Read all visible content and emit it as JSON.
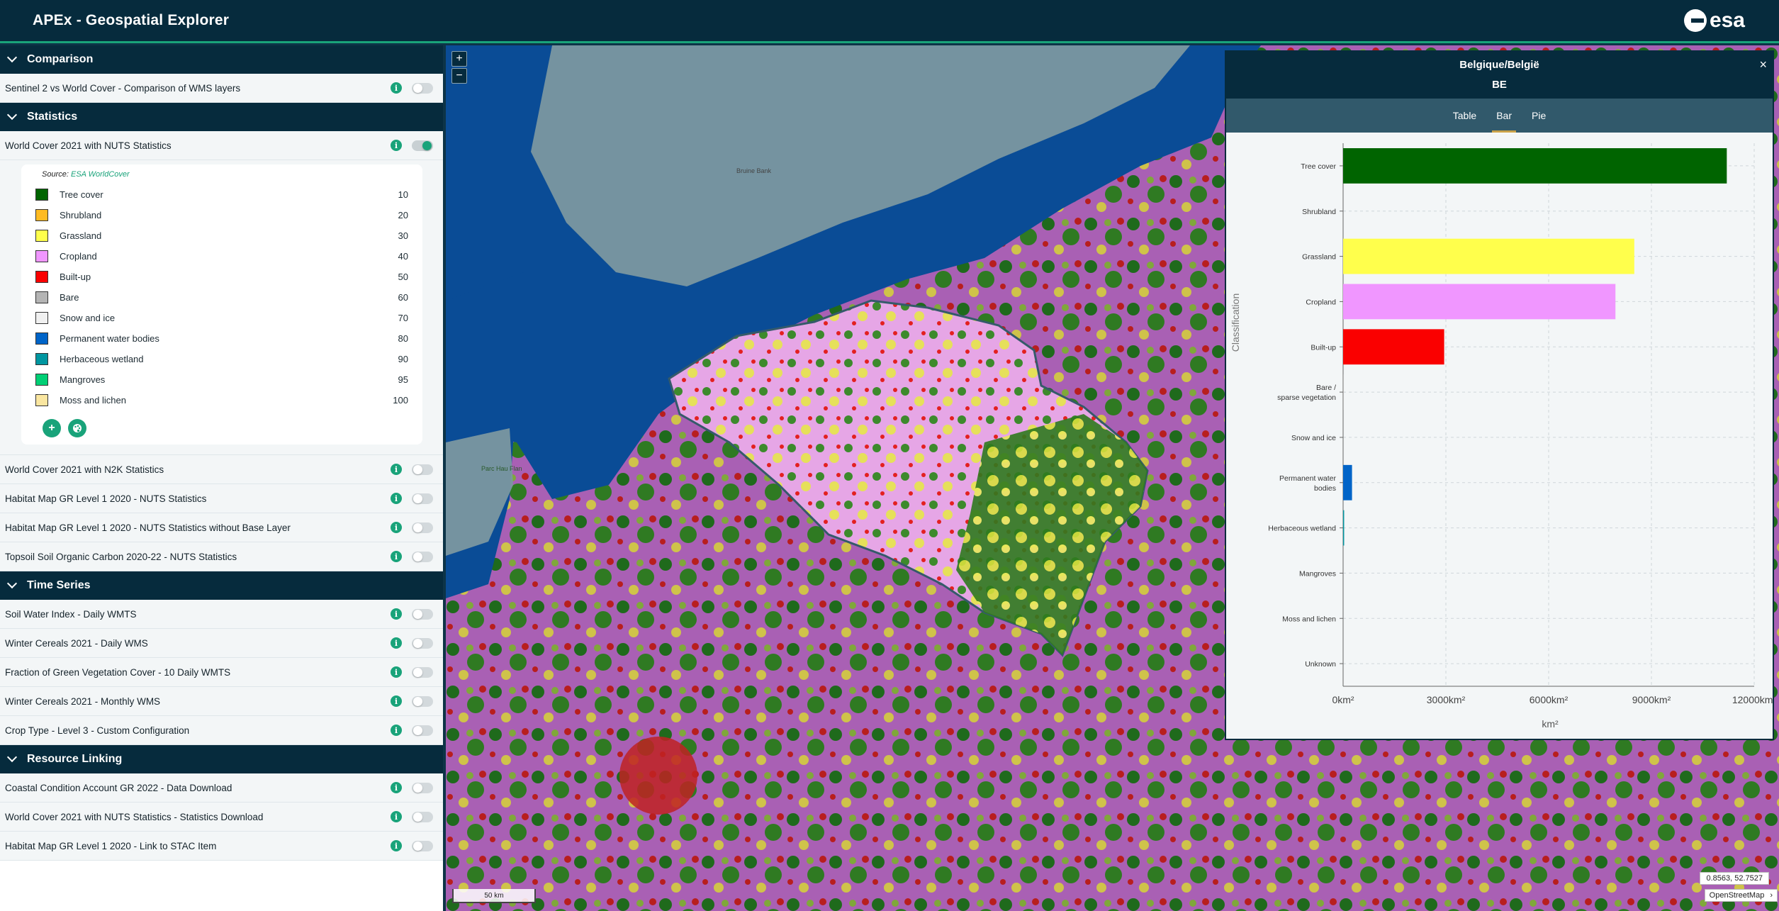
{
  "app": {
    "title": "APEx - Geospatial Explorer",
    "logo_text": "esa"
  },
  "sidebar": {
    "sections": [
      {
        "title": "Comparison",
        "layers": [
          {
            "label": "Sentinel 2 vs World Cover - Comparison of WMS layers",
            "on": false
          }
        ]
      },
      {
        "title": "Statistics",
        "layers": [
          {
            "label": "World Cover 2021 with NUTS Statistics",
            "on": true
          },
          {
            "label": "World Cover 2021 with N2K Statistics",
            "on": false
          },
          {
            "label": "Habitat Map GR Level 1 2020 - NUTS Statistics",
            "on": false
          },
          {
            "label": "Habitat Map GR Level 1 2020 - NUTS Statistics without Base Layer",
            "on": false
          },
          {
            "label": "Topsoil Soil Organic Carbon 2020-22 - NUTS Statistics",
            "on": false
          }
        ]
      },
      {
        "title": "Time Series",
        "layers": [
          {
            "label": "Soil Water Index - Daily WMTS",
            "on": false
          },
          {
            "label": "Winter Cereals 2021 - Daily WMS",
            "on": false
          },
          {
            "label": "Fraction of Green Vegetation Cover - 10 Daily WMTS",
            "on": false
          },
          {
            "label": "Winter Cereals 2021 - Monthly WMS",
            "on": false
          },
          {
            "label": "Crop Type - Level 3 - Custom Configuration",
            "on": false
          }
        ]
      },
      {
        "title": "Resource Linking",
        "layers": [
          {
            "label": "Coastal Condition Account GR 2022 - Data Download",
            "on": false
          },
          {
            "label": "World Cover 2021 with NUTS Statistics - Statistics Download",
            "on": false
          },
          {
            "label": "Habitat Map GR Level 1 2020 - Link to STAC Item",
            "on": false
          }
        ]
      }
    ],
    "legend": {
      "source_prefix": "Source:",
      "source_link": "ESA WorldCover",
      "items": [
        {
          "name": "Tree cover",
          "value": "10",
          "color": "#006400"
        },
        {
          "name": "Shrubland",
          "value": "20",
          "color": "#ffbb22"
        },
        {
          "name": "Grassland",
          "value": "30",
          "color": "#ffff4c"
        },
        {
          "name": "Cropland",
          "value": "40",
          "color": "#f096ff"
        },
        {
          "name": "Built-up",
          "value": "50",
          "color": "#fa0000"
        },
        {
          "name": "Bare",
          "value": "60",
          "color": "#b4b4b4"
        },
        {
          "name": "Snow and ice",
          "value": "70",
          "color": "#f0f0f0"
        },
        {
          "name": "Permanent water bodies",
          "value": "80",
          "color": "#0064c8"
        },
        {
          "name": "Herbaceous wetland",
          "value": "90",
          "color": "#0096a0"
        },
        {
          "name": "Mangroves",
          "value": "95",
          "color": "#00cf75"
        },
        {
          "name": "Moss and lichen",
          "value": "100",
          "color": "#fae6a0"
        }
      ],
      "add_icon": "+",
      "palette_icon": "palette-icon"
    }
  },
  "map": {
    "zoom_in": "+",
    "zoom_out": "−",
    "scale": "50 km",
    "coords": "0.8563, 52.7527",
    "attribution": "OpenStreetMap",
    "attribution_toggle": "›",
    "place_labels": [
      "Bruine Bank",
      "Parc Hau Flan"
    ]
  },
  "stats_panel": {
    "title": "Belgique/België",
    "code": "BE",
    "close": "×",
    "tabs": [
      "Table",
      "Bar",
      "Pie"
    ],
    "active_tab": "Bar"
  },
  "chart_data": {
    "type": "bar",
    "orientation": "horizontal",
    "categories": [
      "Tree cover",
      "Shrubland",
      "Grassland",
      "Cropland",
      "Built-up",
      "Bare / sparse vegetation",
      "Snow and ice",
      "Permanent water bodies",
      "Herbaceous wetland",
      "Mangroves",
      "Moss and lichen",
      "Unknown"
    ],
    "values": [
      11200,
      0,
      8500,
      7950,
      2950,
      20,
      0,
      260,
      30,
      0,
      0,
      0
    ],
    "colors": [
      "#006400",
      "#ffbb22",
      "#ffff4c",
      "#f096ff",
      "#fa0000",
      "#b4b4b4",
      "#f0f0f0",
      "#0064c8",
      "#0096a0",
      "#00cf75",
      "#fae6a0",
      "#888888"
    ],
    "xlabel": "km²",
    "ylabel": "Classification",
    "xlim": [
      0,
      12000
    ],
    "xticks": [
      "0km²",
      "3000km²",
      "6000km²",
      "9000km²",
      "12000km²"
    ],
    "grid": true
  }
}
